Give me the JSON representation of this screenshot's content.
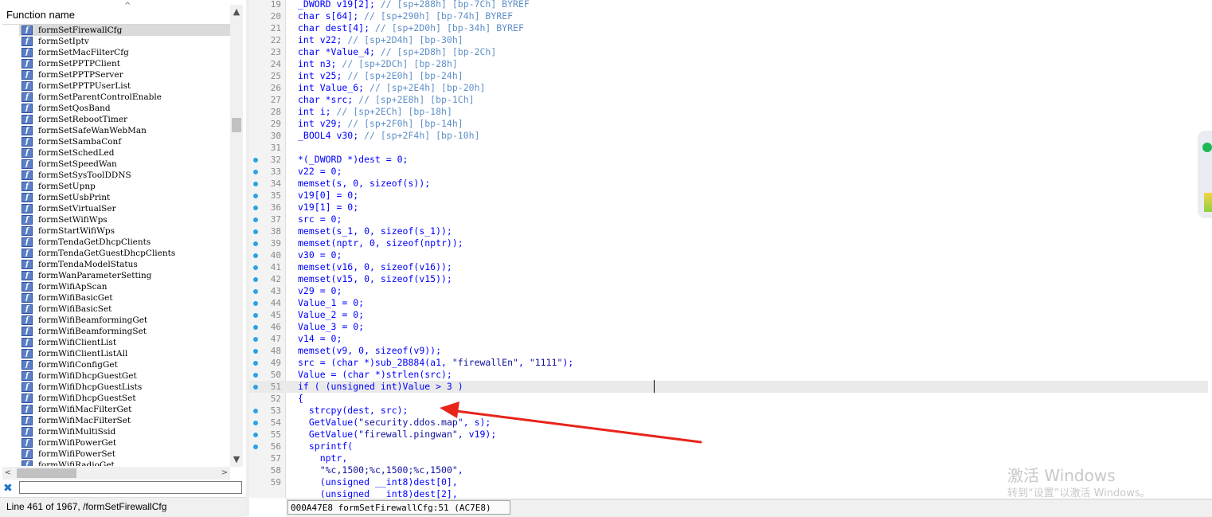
{
  "functions_panel": {
    "header": "Function name",
    "sort_indicator": "^",
    "selected": "formSetFirewallCfg",
    "items": [
      "formSetFirewallCfg",
      "formSetIptv",
      "formSetMacFilterCfg",
      "formSetPPTPClient",
      "formSetPPTPServer",
      "formSetPPTPUserList",
      "formSetParentControlEnable",
      "formSetQosBand",
      "formSetRebootTimer",
      "formSetSafeWanWebMan",
      "formSetSambaConf",
      "formSetSchedLed",
      "formSetSpeedWan",
      "formSetSysToolDDNS",
      "formSetUpnp",
      "formSetUsbPrint",
      "formSetVirtualSer",
      "formSetWifiWps",
      "formStartWifiWps",
      "formTendaGetDhcpClients",
      "formTendaGetGuestDhcpClients",
      "formTendaModelStatus",
      "formWanParameterSetting",
      "formWifiApScan",
      "formWifiBasicGet",
      "formWifiBasicSet",
      "formWifiBeamformingGet",
      "formWifiBeamformingSet",
      "formWifiClientList",
      "formWifiClientListAll",
      "formWifiConfigGet",
      "formWifiDhcpGuestGet",
      "formWifiDhcpGuestLists",
      "formWifiDhcpGuestSet",
      "formWifiMacFilterGet",
      "formWifiMacFilterSet",
      "formWifiMultiSsid",
      "formWifiPowerGet",
      "formWifiPowerSet",
      "formWifiRadioGet"
    ],
    "filter_close_icon": "close-x-icon",
    "filter_value": "",
    "status": "Line 461 of 1967, /formSetFirewallCfg"
  },
  "code_panel": {
    "colors": {
      "keyword": "#0000ff",
      "comment": "#5f8fc8",
      "string": "#1010a0",
      "identifier": "#0000ff",
      "gray": "#808080",
      "breakpoint_dot": "#29a3e6",
      "arrow": "#e8231a"
    },
    "current_line": 51,
    "lines": [
      {
        "n": "19",
        "dot": false,
        "text": "_DWORD v19[2]; // [sp+288h] [bp-7Ch] BYREF"
      },
      {
        "n": "20",
        "dot": false,
        "text": "char s[64]; // [sp+290h] [bp-74h] BYREF"
      },
      {
        "n": "21",
        "dot": false,
        "text": "char dest[4]; // [sp+2D0h] [bp-34h] BYREF"
      },
      {
        "n": "22",
        "dot": false,
        "text": "int v22; // [sp+2D4h] [bp-30h]"
      },
      {
        "n": "23",
        "dot": false,
        "text": "char *Value_4; // [sp+2D8h] [bp-2Ch]"
      },
      {
        "n": "24",
        "dot": false,
        "text": "int n3; // [sp+2DCh] [bp-28h]"
      },
      {
        "n": "25",
        "dot": false,
        "text": "int v25; // [sp+2E0h] [bp-24h]"
      },
      {
        "n": "26",
        "dot": false,
        "text": "int Value_6; // [sp+2E4h] [bp-20h]"
      },
      {
        "n": "27",
        "dot": false,
        "text": "char *src; // [sp+2E8h] [bp-1Ch]"
      },
      {
        "n": "28",
        "dot": false,
        "text": "int i; // [sp+2ECh] [bp-18h]"
      },
      {
        "n": "29",
        "dot": false,
        "text": "int v29; // [sp+2F0h] [bp-14h]"
      },
      {
        "n": "30",
        "dot": false,
        "text": "_BOOL4 v30; // [sp+2F4h] [bp-10h]"
      },
      {
        "n": "31",
        "dot": false,
        "text": ""
      },
      {
        "n": "32",
        "dot": true,
        "text": "*(_DWORD *)dest = 0;"
      },
      {
        "n": "33",
        "dot": true,
        "text": "v22 = 0;"
      },
      {
        "n": "34",
        "dot": true,
        "text": "memset(s, 0, sizeof(s));"
      },
      {
        "n": "35",
        "dot": true,
        "text": "v19[0] = 0;"
      },
      {
        "n": "36",
        "dot": true,
        "text": "v19[1] = 0;"
      },
      {
        "n": "37",
        "dot": true,
        "text": "src = 0;"
      },
      {
        "n": "38",
        "dot": true,
        "text": "memset(s_1, 0, sizeof(s_1));"
      },
      {
        "n": "39",
        "dot": true,
        "text": "memset(nptr, 0, sizeof(nptr));"
      },
      {
        "n": "40",
        "dot": true,
        "text": "v30 = 0;"
      },
      {
        "n": "41",
        "dot": true,
        "text": "memset(v16, 0, sizeof(v16));"
      },
      {
        "n": "42",
        "dot": true,
        "text": "memset(v15, 0, sizeof(v15));"
      },
      {
        "n": "43",
        "dot": true,
        "text": "v29 = 0;"
      },
      {
        "n": "44",
        "dot": true,
        "text": "Value_1 = 0;"
      },
      {
        "n": "45",
        "dot": true,
        "text": "Value_2 = 0;"
      },
      {
        "n": "46",
        "dot": true,
        "text": "Value_3 = 0;"
      },
      {
        "n": "47",
        "dot": true,
        "text": "v14 = 0;"
      },
      {
        "n": "48",
        "dot": true,
        "text": "memset(v9, 0, sizeof(v9));"
      },
      {
        "n": "49",
        "dot": true,
        "text": "src = (char *)sub_2B884(a1, \"firewallEn\", \"1111\");"
      },
      {
        "n": "50",
        "dot": true,
        "text": "Value = (char *)strlen(src);"
      },
      {
        "n": "51",
        "dot": true,
        "text": "if ( (unsigned int)Value > 3 )"
      },
      {
        "n": "52",
        "dot": false,
        "text": "{"
      },
      {
        "n": "53",
        "dot": true,
        "text": "  strcpy(dest, src);"
      },
      {
        "n": "54",
        "dot": true,
        "text": "  GetValue(\"security.ddos.map\", s);"
      },
      {
        "n": "55",
        "dot": true,
        "text": "  GetValue(\"firewall.pingwan\", v19);"
      },
      {
        "n": "56",
        "dot": true,
        "text": "  sprintf("
      },
      {
        "n": "57",
        "dot": false,
        "text": "    nptr,"
      },
      {
        "n": "58",
        "dot": false,
        "text": "    \"%c,1500;%c,1500;%c,1500\","
      },
      {
        "n": "59",
        "dot": false,
        "text": "    (unsigned __int8)dest[0],"
      },
      {
        "n": "",
        "dot": false,
        "text": "    (unsigned __int8)dest[2],"
      }
    ],
    "status": "000A47E8 formSetFirewallCfg:51 (AC7E8)"
  },
  "watermark": {
    "title": "激活 Windows",
    "subtitle": "转到“设置”以激活 Windows。"
  }
}
